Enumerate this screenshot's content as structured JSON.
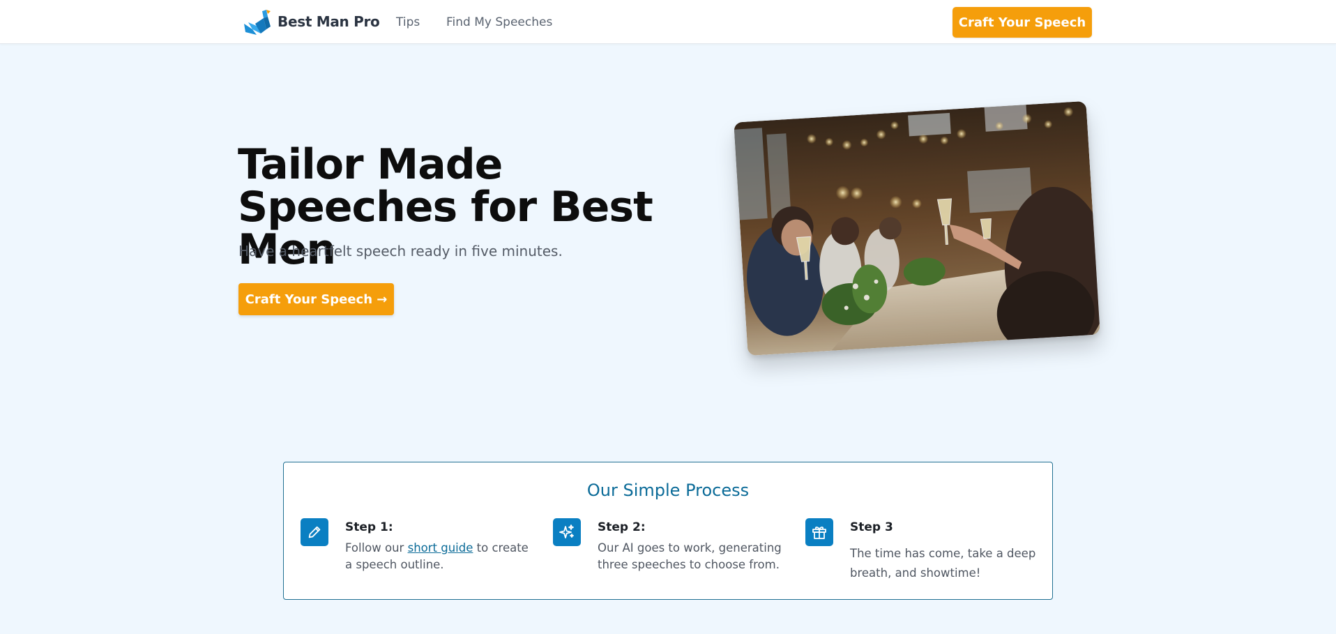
{
  "header": {
    "brand": "Best Man Pro",
    "nav": [
      {
        "label": "Tips"
      },
      {
        "label": "Find My Speeches"
      }
    ],
    "cta_label": "Craft Your Speech"
  },
  "hero": {
    "title": "Tailor Made Speeches for Best Men",
    "subtitle": "Have a heartfelt speech ready in five minutes.",
    "cta_label": "Craft Your Speech →",
    "image_icon": "wedding-toast-photo"
  },
  "process": {
    "title": "Our Simple Process",
    "steps": [
      {
        "icon": "pencil-icon",
        "title": "Step 1:",
        "desc_before": "Follow our ",
        "desc_link": "short guide",
        "desc_after": " to create a speech outline."
      },
      {
        "icon": "sparkles-icon",
        "title": "Step 2:",
        "desc": "Our AI goes to work, generating three speeches to choose from."
      },
      {
        "icon": "gift-icon",
        "title": "Step 3",
        "desc": "The time has come, take a deep breath, and showtime!"
      }
    ]
  },
  "colors": {
    "accent": "#f59e0b",
    "brand_blue": "#0a7fc2",
    "background": "#eff7fe"
  }
}
